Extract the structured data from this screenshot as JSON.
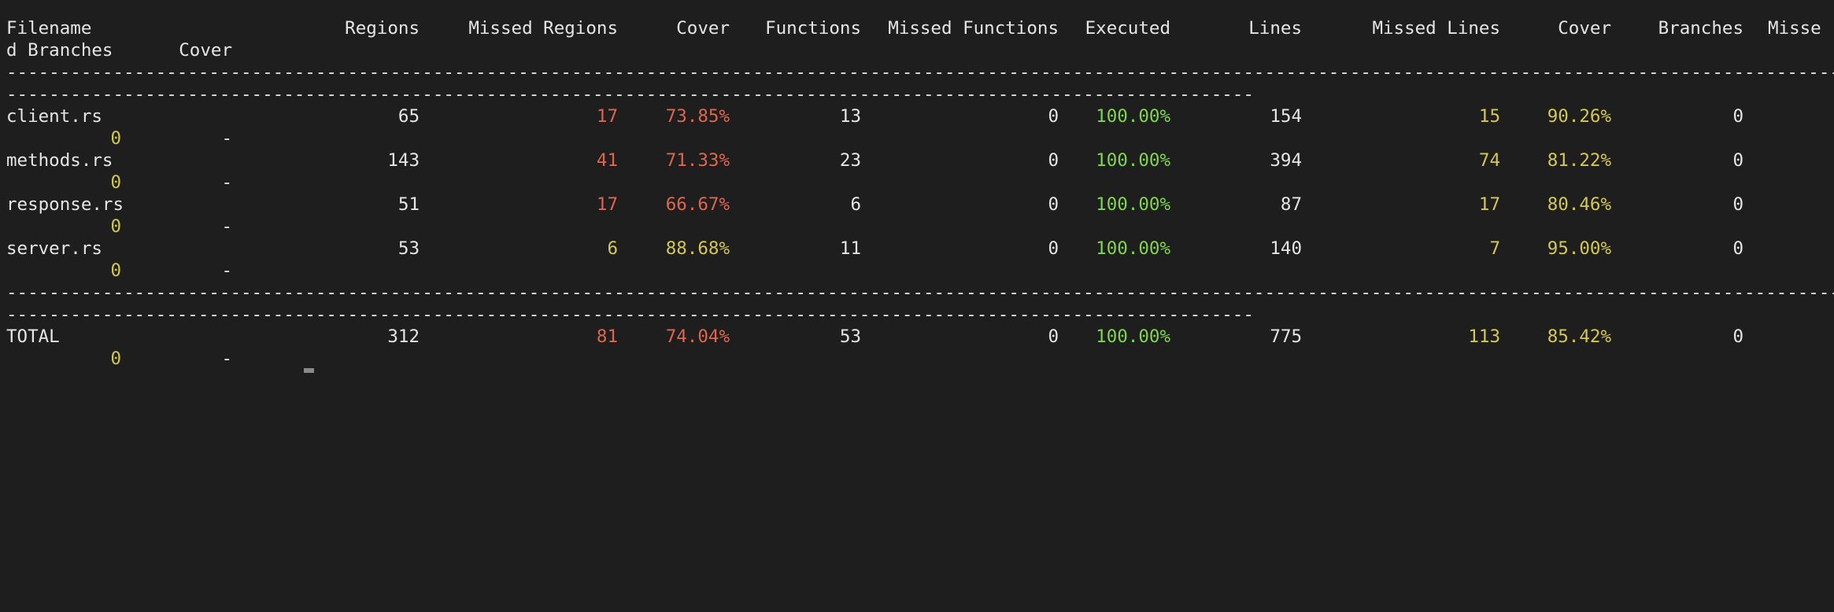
{
  "header": {
    "filename": "Filename",
    "regions": "Regions",
    "missed_regions": "Missed Regions",
    "cover1": "Cover",
    "functions": "Functions",
    "missed_functions": "Missed Functions",
    "executed": "Executed",
    "lines": "Lines",
    "missed_lines": "Missed Lines",
    "cover2": "Cover",
    "branches": "Branches",
    "missed_branches_part1": "Misse",
    "missed_branches_part2": "d Branches",
    "cover3": "Cover"
  },
  "separator": "--------------------------------------------------------------------------------------------------------------------------------------------------------------------------------------------------------------------------------------------------------------",
  "separator_wrap": "-------------------------------------------------------------------------------------------------------------------------------------------------------------------",
  "rows": [
    {
      "filename": "client.rs",
      "regions": "65",
      "missed_regions": "17",
      "cover1": "73.85%",
      "functions": "13",
      "missed_functions": "0",
      "executed": "100.00%",
      "lines": "154",
      "missed_lines": "15",
      "cover2": "90.26%",
      "branches": "0",
      "missed_branches": "0",
      "cover3": "-"
    },
    {
      "filename": "methods.rs",
      "regions": "143",
      "missed_regions": "41",
      "cover1": "71.33%",
      "functions": "23",
      "missed_functions": "0",
      "executed": "100.00%",
      "lines": "394",
      "missed_lines": "74",
      "cover2": "81.22%",
      "branches": "0",
      "missed_branches": "0",
      "cover3": "-"
    },
    {
      "filename": "response.rs",
      "regions": "51",
      "missed_regions": "17",
      "cover1": "66.67%",
      "functions": "6",
      "missed_functions": "0",
      "executed": "100.00%",
      "lines": "87",
      "missed_lines": "17",
      "cover2": "80.46%",
      "branches": "0",
      "missed_branches": "0",
      "cover3": "-"
    },
    {
      "filename": "server.rs",
      "regions": "53",
      "missed_regions": "6",
      "cover1": "88.68%",
      "functions": "11",
      "missed_functions": "0",
      "executed": "100.00%",
      "lines": "140",
      "missed_lines": "7",
      "cover2": "95.00%",
      "branches": "0",
      "missed_branches": "0",
      "cover3": "-"
    }
  ],
  "total": {
    "filename": "TOTAL",
    "regions": "312",
    "missed_regions": "81",
    "cover1": "74.04%",
    "functions": "53",
    "missed_functions": "0",
    "executed": "100.00%",
    "lines": "775",
    "missed_lines": "113",
    "cover2": "85.42%",
    "branches": "0",
    "missed_branches": "0",
    "cover3": "-"
  },
  "colors": {
    "background": "#1e1e1e",
    "foreground": "#e6e6e6",
    "red": "#e0654f",
    "yellow": "#d4c94d",
    "green": "#7fd74c"
  }
}
